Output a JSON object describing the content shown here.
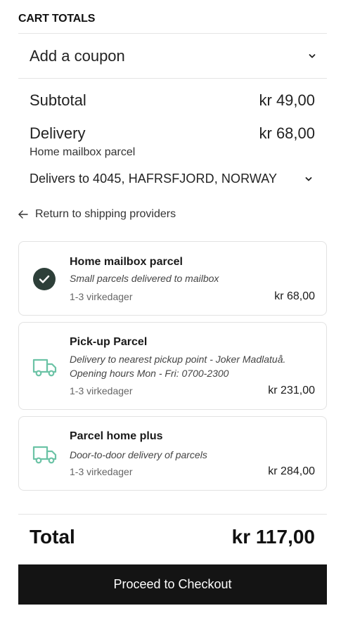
{
  "cart": {
    "title": "CART TOTALS",
    "coupon_label": "Add a coupon",
    "subtotal_label": "Subtotal",
    "subtotal_value": "kr 49,00",
    "delivery_label": "Delivery",
    "delivery_value": "kr 68,00",
    "delivery_method": "Home mailbox parcel",
    "delivers_to_prefix": "Delivers to",
    "delivers_to_address": "4045, HAFRSFJORD, NORWAY",
    "return_link": "Return to shipping providers",
    "total_label": "Total",
    "total_value": "kr 117,00",
    "checkout_label": "Proceed to Checkout"
  },
  "shipping_options": [
    {
      "name": "Home mailbox parcel",
      "description": "Small parcels delivered to mailbox",
      "time": "1-3 virkedager",
      "price": "kr 68,00",
      "selected": true,
      "icon": "check-circle-icon"
    },
    {
      "name": "Pick-up Parcel",
      "description": "Delivery to nearest pickup point - Joker Madlatuå. Opening hours Mon - Fri: 0700-2300",
      "time": "1-3 virkedager",
      "price": "kr 231,00",
      "selected": false,
      "icon": "truck-icon"
    },
    {
      "name": "Parcel home plus",
      "description": "Door-to-door delivery of parcels",
      "time": "1-3 virkedager",
      "price": "kr 284,00",
      "selected": false,
      "icon": "truck-icon"
    }
  ],
  "colors": {
    "selected_check_bg": "#2d3f39",
    "truck_icon": "#6cc3a6",
    "checkout_bg": "#141414"
  }
}
